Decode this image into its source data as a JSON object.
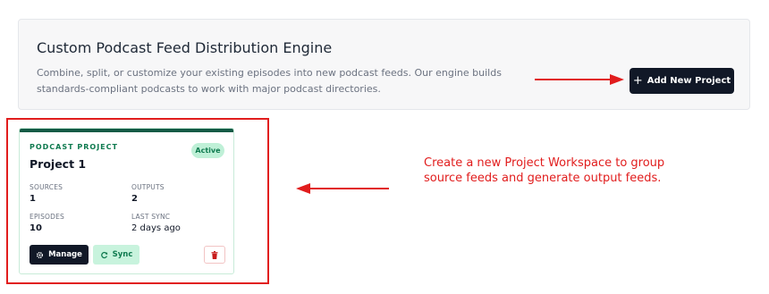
{
  "hero": {
    "title": "Custom Podcast Feed Distribution Engine",
    "description": "Combine, split, or customize your existing episodes into new podcast feeds. Our engine builds standards-compliant podcasts to work with major podcast directories.",
    "add_button": {
      "icon": "plus-icon",
      "label": "Add New Project"
    }
  },
  "project_card": {
    "eyebrow": "PODCAST PROJECT",
    "status": "Active",
    "title": "Project 1",
    "stats": {
      "sources": {
        "label": "SOURCES",
        "value": "1"
      },
      "outputs": {
        "label": "OUTPUTS",
        "value": "2"
      },
      "episodes": {
        "label": "EPISODES",
        "value": "10"
      },
      "last_sync": {
        "label": "LAST SYNC",
        "value": "2 days ago"
      }
    },
    "actions": {
      "manage": {
        "icon": "gear-icon",
        "label": "Manage"
      },
      "sync": {
        "icon": "refresh-icon",
        "label": "Sync"
      },
      "delete": {
        "icon": "trash-icon"
      }
    }
  },
  "annotation": {
    "callout": "Create a new Project Workspace to group source feeds and generate output feeds."
  },
  "colors": {
    "brand_dark": "#111827",
    "accent_green": "#0f7a4f",
    "annotation_red": "#e11d1d"
  }
}
